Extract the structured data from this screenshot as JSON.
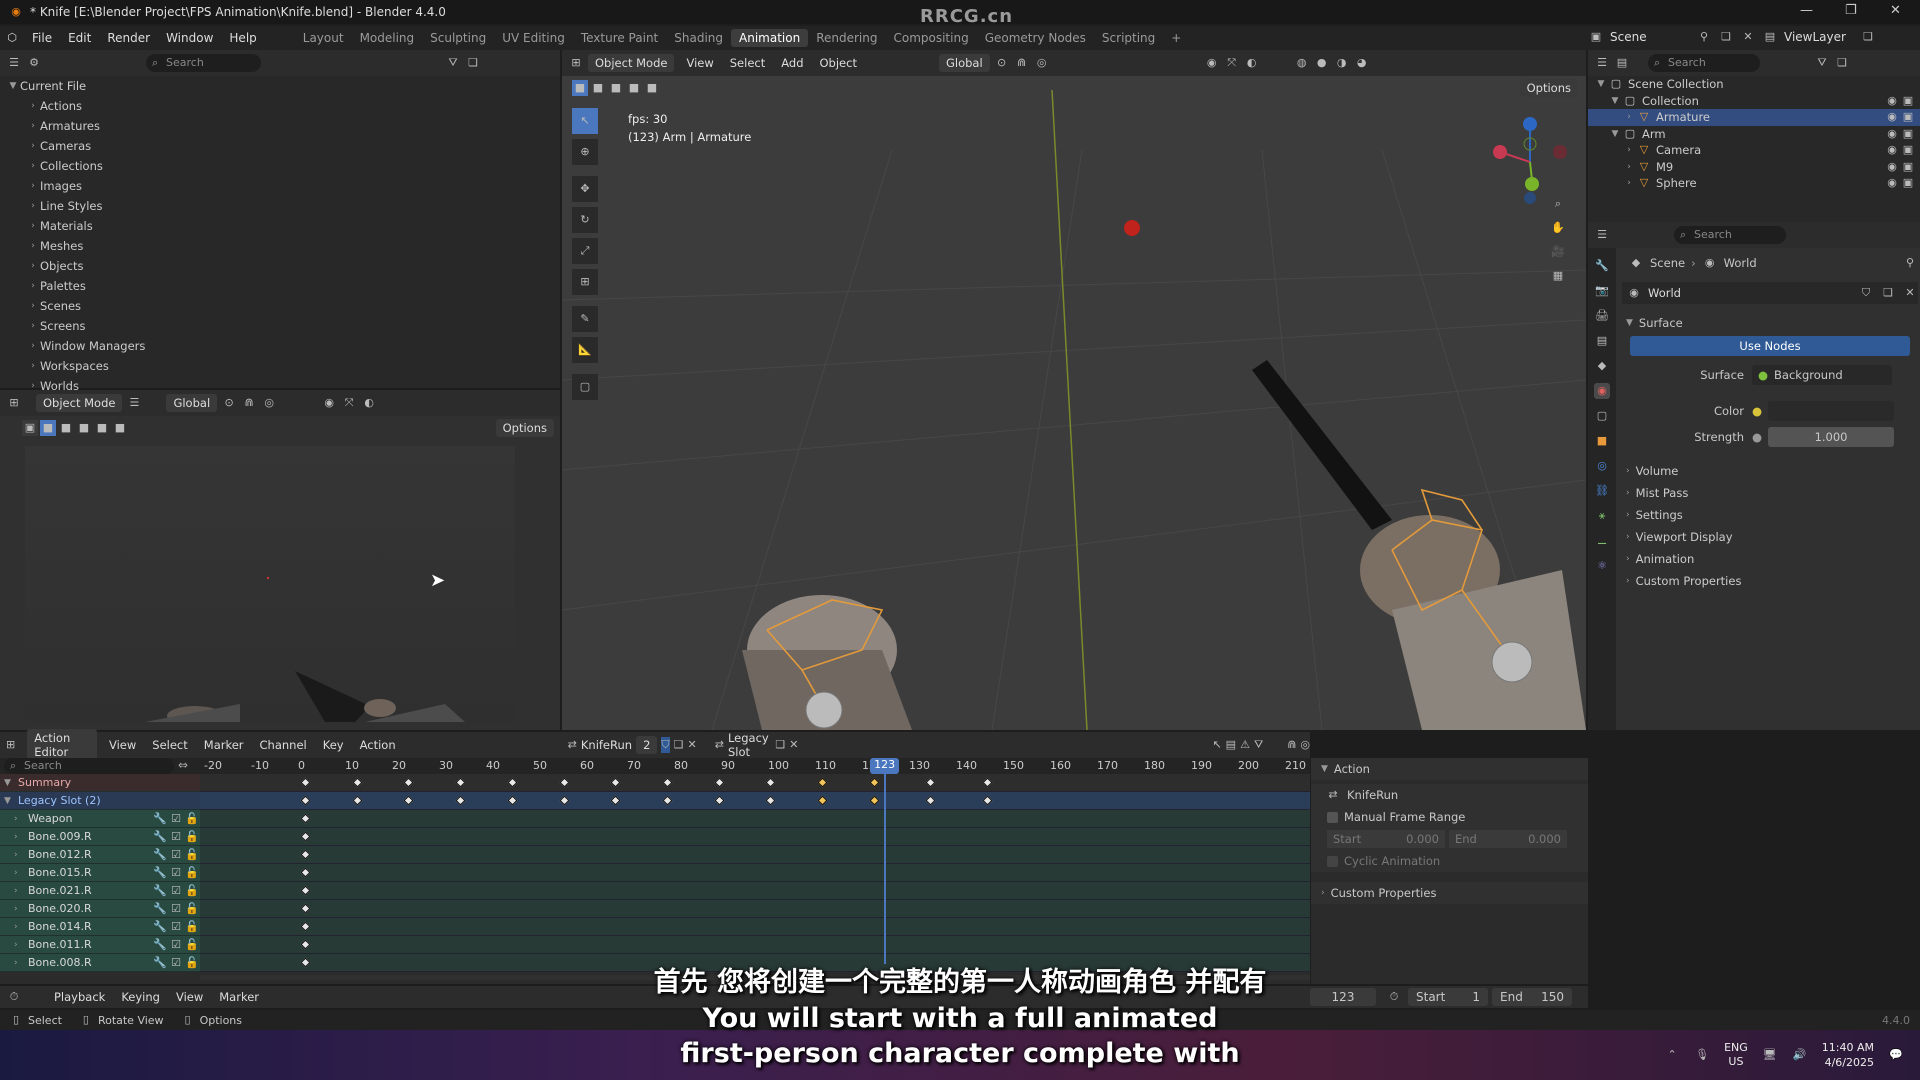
{
  "titlebar": {
    "title": "* Knife [E:\\Blender Project\\FPS Animation\\Knife.blend] - Blender 4.4.0",
    "watermark": "RRCG.cn"
  },
  "menu": [
    "File",
    "Edit",
    "Render",
    "Window",
    "Help"
  ],
  "workspaces": [
    "Layout",
    "Modeling",
    "Sculpting",
    "UV Editing",
    "Texture Paint",
    "Shading",
    "Animation",
    "Rendering",
    "Compositing",
    "Geometry Nodes",
    "Scripting"
  ],
  "active_workspace": "Animation",
  "scene": {
    "label": "Scene",
    "viewlayer": "ViewLayer"
  },
  "filebrowser": {
    "search": "Search",
    "root": "Current File",
    "items": [
      "Actions",
      "Armatures",
      "Cameras",
      "Collections",
      "Images",
      "Line Styles",
      "Materials",
      "Meshes",
      "Objects",
      "Palettes",
      "Scenes",
      "Screens",
      "Window Managers",
      "Workspaces",
      "Worlds"
    ]
  },
  "cam_view": {
    "mode": "Object Mode",
    "orient": "Global",
    "options": "Options"
  },
  "viewport": {
    "mode": "Object Mode",
    "menus": [
      "View",
      "Select",
      "Add",
      "Object"
    ],
    "orient": "Global",
    "options": "Options",
    "fps": "fps: 30",
    "info": "(123) Arm | Armature"
  },
  "outliner": {
    "search": "Search",
    "items": [
      {
        "name": "Scene Collection",
        "depth": 0
      },
      {
        "name": "Collection",
        "depth": 1
      },
      {
        "name": "Armature",
        "depth": 2,
        "selected": true
      },
      {
        "name": "Arm",
        "depth": 1
      },
      {
        "name": "Camera",
        "depth": 2
      },
      {
        "name": "M9",
        "depth": 2
      },
      {
        "name": "Sphere",
        "depth": 2
      }
    ]
  },
  "properties": {
    "search": "Search",
    "breadcrumb": [
      "Scene",
      "World"
    ],
    "world": "World",
    "surface_header": "Surface",
    "use_nodes": "Use Nodes",
    "surface_label": "Surface",
    "surface_value": "Background",
    "color_label": "Color",
    "strength_label": "Strength",
    "strength_value": "1.000",
    "sections": [
      "Volume",
      "Mist Pass",
      "Settings",
      "Viewport Display",
      "Animation",
      "Custom Properties"
    ]
  },
  "action_editor": {
    "mode": "Action Editor",
    "menus": [
      "View",
      "Select",
      "Marker",
      "Channel",
      "Key",
      "Action"
    ],
    "action": "KnifeRun",
    "users": "2",
    "slot": "Legacy Slot",
    "search": "Search",
    "ruler": [
      "-20",
      "-10",
      "0",
      "10",
      "20",
      "30",
      "40",
      "50",
      "60",
      "70",
      "80",
      "90",
      "100",
      "110",
      "120",
      "130",
      "140",
      "150",
      "160",
      "170",
      "180",
      "190",
      "200",
      "210"
    ],
    "current_frame": "123",
    "channels": [
      "Summary",
      "Legacy Slot (2)",
      "Weapon",
      "Bone.009.R",
      "Bone.012.R",
      "Bone.015.R",
      "Bone.021.R",
      "Bone.020.R",
      "Bone.014.R",
      "Bone.011.R",
      "Bone.008.R"
    ],
    "keyframes": [
      0,
      11,
      22,
      33,
      44,
      55,
      66,
      77,
      88,
      99,
      110,
      121,
      133,
      145
    ],
    "selected_keys": [
      110,
      121
    ]
  },
  "action_panel": {
    "header": "Action",
    "name": "KnifeRun",
    "manual": "Manual Frame Range",
    "start_label": "Start",
    "start": "0.000",
    "end_label": "End",
    "end": "0.000",
    "cyclic": "Cyclic Animation",
    "custom": "Custom Properties"
  },
  "timeline": {
    "menus": [
      "Playback",
      "Keying",
      "View",
      "Marker"
    ],
    "frame": "123",
    "start_label": "Start",
    "start": "1",
    "end_label": "End",
    "end": "150"
  },
  "statusbar": {
    "items": [
      "Select",
      "Rotate View",
      "Options"
    ],
    "version": "4.4.0"
  },
  "taskbar": {
    "lang1": "ENG",
    "lang2": "US",
    "time": "11:40 AM",
    "date": "4/6/2025"
  },
  "subtitles": {
    "zh": "首先 您将创建一个完整的第一人称动画角色 并配有",
    "en1": "You will start with a full animated",
    "en2": "first-person character complete with"
  },
  "colors": {
    "accent": "#2f5a95",
    "keyframe_selected": "#f2c55a",
    "timeline_bg": "#283a36",
    "playhead": "#4b77be"
  }
}
